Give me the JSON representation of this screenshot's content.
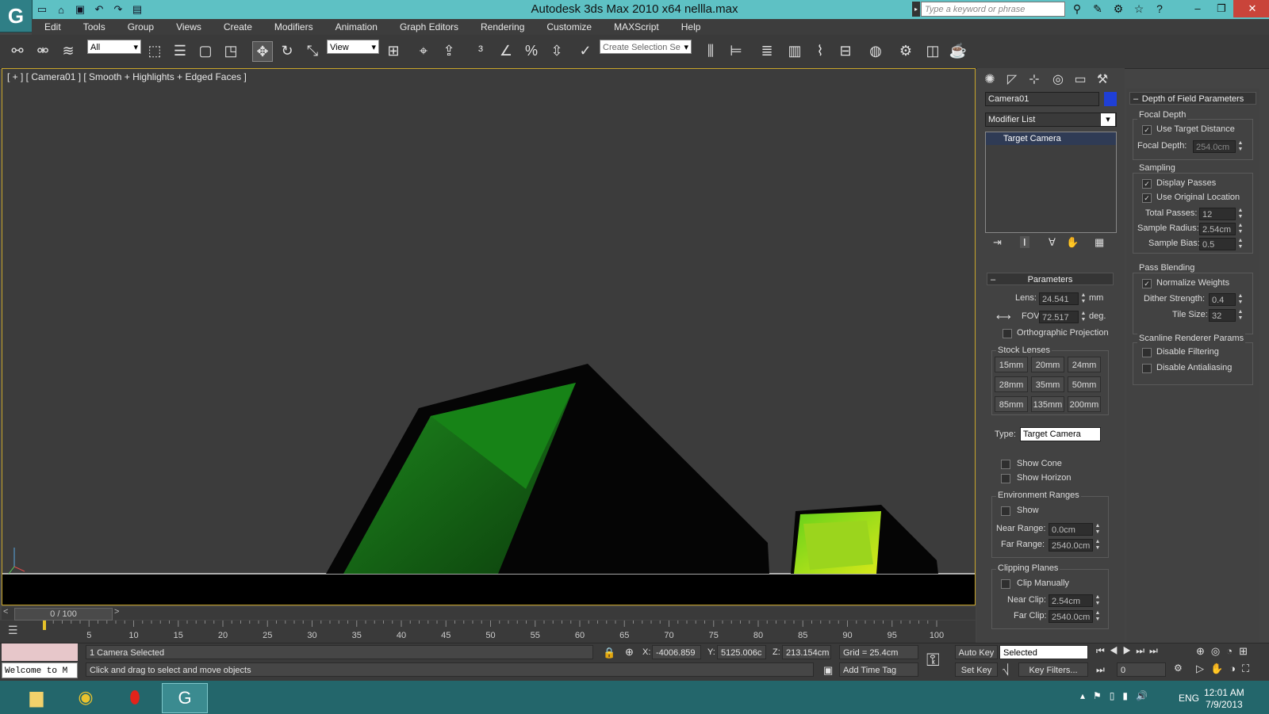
{
  "window": {
    "title": "Autodesk 3ds Max  2010 x64        nellla.max",
    "search_placeholder": "Type a keyword or phrase",
    "controls": [
      "–",
      "❐",
      "✕"
    ]
  },
  "menu": [
    "Edit",
    "Tools",
    "Group",
    "Views",
    "Create",
    "Modifiers",
    "Animation",
    "Graph Editors",
    "Rendering",
    "Customize",
    "MAXScript",
    "Help"
  ],
  "toolbar": {
    "filter_value": "All",
    "coord_value": "View",
    "selection_set_placeholder": "Create Selection Se"
  },
  "viewport": {
    "label": "[ + ] [ Camera01 ] [ Smooth + Highlights + Edged Faces ]"
  },
  "timeline": {
    "frame": "0 / 100",
    "prev": "<",
    "next": ">",
    "ticks": [
      "5",
      "10",
      "15",
      "20",
      "25",
      "30",
      "35",
      "40",
      "45",
      "50",
      "55",
      "60",
      "65",
      "70",
      "75",
      "80",
      "85",
      "90",
      "95",
      "100"
    ]
  },
  "status": {
    "selected": "1 Camera Selected",
    "prompt": "Click and drag to select and move objects",
    "welcome": "Welcome to M",
    "x_label": "X:",
    "x_value": "-4006.859",
    "y_label": "Y:",
    "y_value": "5125.006c",
    "z_label": "Z:",
    "z_value": "213.154cm",
    "grid": "Grid = 25.4cm",
    "add_time_tag": "Add Time Tag",
    "auto_key": "Auto Key",
    "set_key": "Set Key",
    "selected_dropdown": "Selected",
    "key_filters": "Key Filters...",
    "frame_value": "0"
  },
  "command_panel": {
    "object_name": "Camera01",
    "object_color": "#1f3fd6",
    "modifier_list": "Modifier List",
    "stack_item": "Target Camera",
    "parameters": {
      "header": "Parameters",
      "lens_label": "Lens:",
      "lens_value": "24.541",
      "lens_unit": "mm",
      "fov_label": "FOV:",
      "fov_value": "72.517",
      "fov_unit": "deg.",
      "ortho": "Orthographic Projection",
      "stock_lenses": "Stock Lenses",
      "lenses": [
        "15mm",
        "20mm",
        "24mm",
        "28mm",
        "35mm",
        "50mm",
        "85mm",
        "135mm",
        "200mm"
      ],
      "type_label": "Type:",
      "type_value": "Target Camera",
      "show_cone": "Show Cone",
      "show_horizon": "Show Horizon",
      "env_ranges": "Environment Ranges",
      "env_show": "Show",
      "near_range_label": "Near Range:",
      "near_range_value": "0.0cm",
      "far_range_label": "Far Range:",
      "far_range_value": "2540.0cm",
      "clipping_planes": "Clipping Planes",
      "clip_manually": "Clip Manually",
      "near_clip_label": "Near Clip:",
      "near_clip_value": "2.54cm",
      "far_clip_label": "Far Clip:",
      "far_clip_value": "2540.0cm"
    }
  },
  "dof": {
    "header": "Depth of Field Parameters",
    "focal_depth": "Focal Depth",
    "use_target_distance": "Use Target Distance",
    "focal_depth_label": "Focal Depth:",
    "focal_depth_value": "254.0cm",
    "sampling": "Sampling",
    "display_passes": "Display Passes",
    "use_original_location": "Use Original Location",
    "total_passes_label": "Total Passes:",
    "total_passes_value": "12",
    "sample_radius_label": "Sample Radius:",
    "sample_radius_value": "2.54cm",
    "sample_bias_label": "Sample Bias:",
    "sample_bias_value": "0.5",
    "pass_blending": "Pass Blending",
    "normalize_weights": "Normalize Weights",
    "dither_strength_label": "Dither Strength:",
    "dither_strength_value": "0.4",
    "tile_size_label": "Tile Size:",
    "tile_size_value": "32",
    "scanline": "Scanline Renderer Params",
    "disable_filtering": "Disable Filtering",
    "disable_antialiasing": "Disable Antialiasing"
  },
  "taskbar": {
    "lang": "ENG",
    "time": "12:01 AM",
    "date": "7/9/2013"
  }
}
